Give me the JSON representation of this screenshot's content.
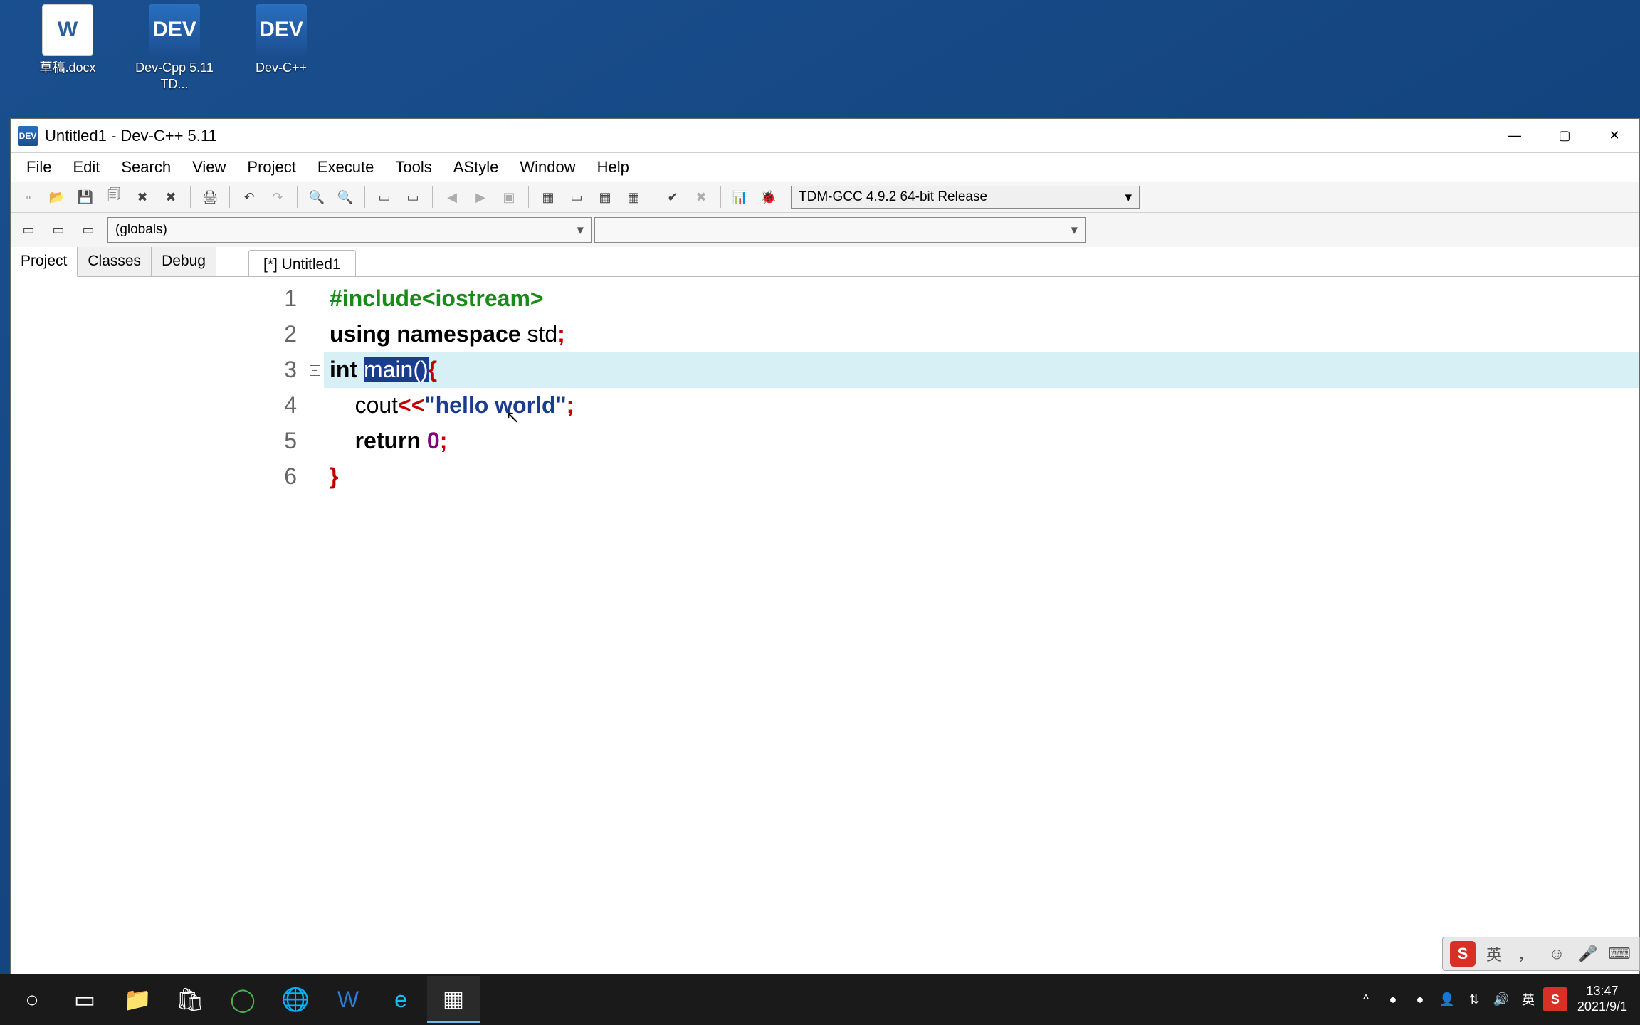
{
  "desktop_icons": [
    {
      "label": "草稿.docx",
      "glyph": "W"
    },
    {
      "label": "Dev-Cpp 5.11 TD...",
      "glyph": "DEV"
    },
    {
      "label": "Dev-C++",
      "glyph": "DEV"
    }
  ],
  "window": {
    "title": "Untitled1 - Dev-C++ 5.11",
    "min": "—",
    "max": "▢",
    "close": "✕"
  },
  "menu": [
    "File",
    "Edit",
    "Search",
    "View",
    "Project",
    "Execute",
    "Tools",
    "AStyle",
    "Window",
    "Help"
  ],
  "toolbar_icons": [
    "▫",
    "▫",
    "💾",
    "🗐",
    "🗐",
    "🗐",
    "|",
    "🖨",
    "|",
    "↶",
    "↷",
    "|",
    "🔍",
    "🔍",
    "|",
    "▭",
    "▭",
    "|",
    "◀",
    "▶",
    "▣",
    "|",
    "▦",
    "▭",
    "▦",
    "▦",
    "|",
    "✔",
    "✖",
    "|",
    "📊",
    "🐞"
  ],
  "compiler": "TDM-GCC 4.9.2 64-bit Release",
  "toolbar2_icons": [
    "▭",
    "▭",
    "▭"
  ],
  "scope_combo": "(globals)",
  "side_tabs": [
    "Project",
    "Classes",
    "Debug"
  ],
  "editor_tab": "[*] Untitled1",
  "code": {
    "line1": "#include<iostream>",
    "line2_kw1": "using",
    "line2_kw2": "namespace",
    "line2_id": "std",
    "line2_semi": ";",
    "line3_kw": "int",
    "line3_sel": "main()",
    "line3_brace": "{",
    "line4_id": "cout",
    "line4_op": "<<",
    "line4_str": "\"hello world\"",
    "line4_semi": ";",
    "line5_kw": "return",
    "line5_num": "0",
    "line5_semi": ";",
    "line6_brace": "}"
  },
  "line_numbers": [
    "1",
    "2",
    "3",
    "4",
    "5",
    "6"
  ],
  "ime": {
    "s": "S",
    "lang": "英"
  },
  "tray": {
    "chevron": "^",
    "lang": "英",
    "time": "13:47",
    "date": "2021/9/1"
  }
}
